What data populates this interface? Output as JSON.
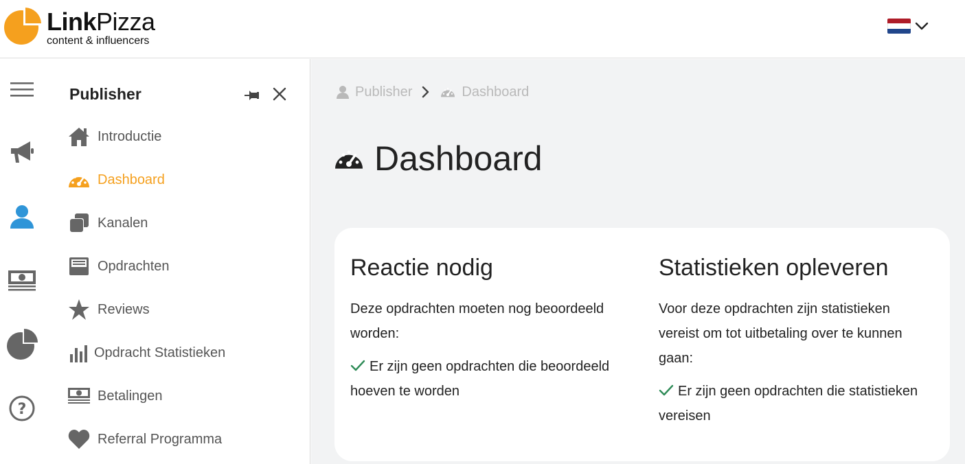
{
  "colors": {
    "accent": "#f5a01e",
    "active_rail": "#2f95d8",
    "check": "#2e8b57",
    "muted": "#b9b9b9"
  },
  "logo": {
    "brand_bold": "Link",
    "brand_regular": "Pizza",
    "tagline": "content & influencers",
    "icon": "pizza-slice-logo"
  },
  "header": {
    "language": {
      "icon": "netherlands-flag-icon",
      "dropdown_icon": "chevron-down-icon"
    }
  },
  "rail": {
    "items": [
      {
        "name": "menu",
        "icon": "hamburger-icon"
      },
      {
        "name": "advertiser",
        "icon": "megaphone-icon"
      },
      {
        "name": "publisher",
        "icon": "user-icon",
        "active": true
      },
      {
        "name": "payments",
        "icon": "money-icon"
      },
      {
        "name": "statistics",
        "icon": "pie-chart-icon"
      },
      {
        "name": "help",
        "icon": "question-icon"
      }
    ]
  },
  "sidebar": {
    "title": "Publisher",
    "items": [
      {
        "label": "Introductie",
        "icon": "home-icon"
      },
      {
        "label": "Dashboard",
        "icon": "tachometer-icon",
        "active": true
      },
      {
        "label": "Kanalen",
        "icon": "clone-icon"
      },
      {
        "label": "Opdrachten",
        "icon": "inbox-icon"
      },
      {
        "label": "Reviews",
        "icon": "star-icon"
      },
      {
        "label": "Opdracht Statistieken",
        "icon": "bar-chart-icon"
      },
      {
        "label": "Betalingen",
        "icon": "money-icon"
      },
      {
        "label": "Referral Programma",
        "icon": "heart-icon"
      }
    ]
  },
  "breadcrumb": [
    {
      "label": "Publisher",
      "icon": "user-icon"
    },
    {
      "label": "Dashboard",
      "icon": "tachometer-icon"
    }
  ],
  "page": {
    "title": "Dashboard",
    "sections": [
      {
        "heading": "Reactie nodig",
        "description": "Deze opdrachten moeten nog beoordeeld worden:",
        "status": "Er zijn geen opdrachten die beoordeeld hoeven te worden"
      },
      {
        "heading": "Statistieken opleveren",
        "description": "Voor deze opdrachten zijn statistieken vereist om tot uitbetaling over te kunnen gaan:",
        "status": "Er zijn geen opdrachten die statistieken vereisen"
      }
    ]
  }
}
